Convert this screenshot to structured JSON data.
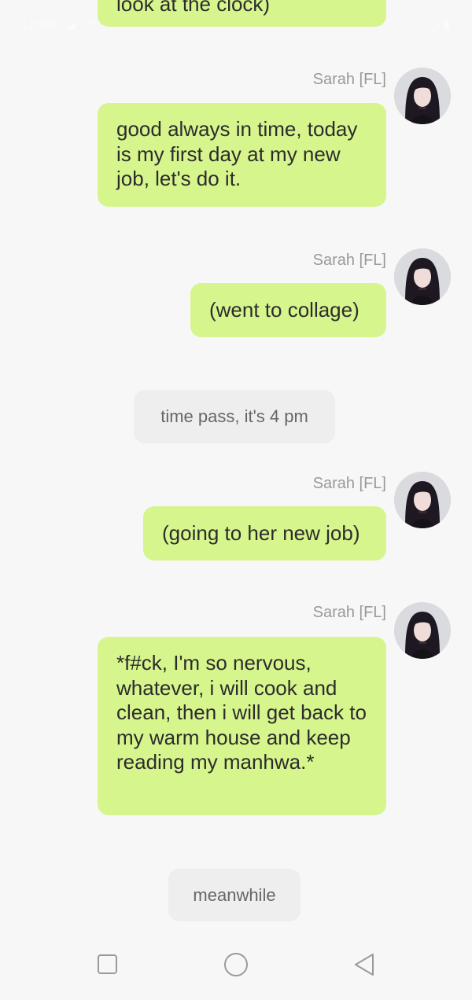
{
  "status_bar": {
    "time": "12:35",
    "colors": {
      "text": "#ffffff"
    }
  },
  "colors": {
    "background": "#f7f7f7",
    "bubble": "#d7f58d",
    "bubble_text": "#2c2c2c",
    "narration_bg": "#eeeeee",
    "narration_text": "#666666",
    "name_text": "#999999"
  },
  "chat": {
    "top_partial_message": "look at the clock)",
    "messages": [
      {
        "sender": "Sarah [FL]",
        "text": "good always in time, today is my first day at my new job, let's do it."
      },
      {
        "sender": "Sarah [FL]",
        "text": "(went to collage)"
      },
      {
        "narration": "time pass, it's 4 pm"
      },
      {
        "sender": "Sarah [FL]",
        "text": "(going to her new job)"
      },
      {
        "sender": "Sarah [FL]",
        "text": "*f#ck, I'm so nervous, whatever, i will cook and clean, then i will get back to my warm house and keep reading my manhwa.*"
      },
      {
        "narration": "meanwhile"
      }
    ]
  },
  "nav_bar": {
    "icons": [
      "square-recents-icon",
      "circle-home-icon",
      "triangle-back-icon"
    ]
  }
}
